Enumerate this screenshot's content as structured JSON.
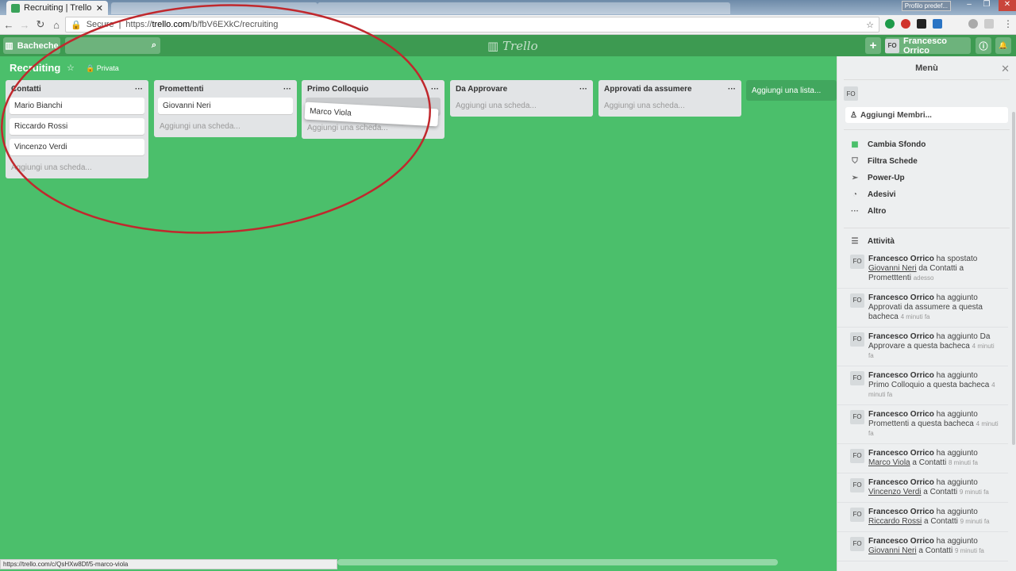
{
  "browser": {
    "tab_title": "Recruiting | Trello",
    "profile": "Profilo predef...",
    "url_secure": "Secure",
    "url_prefix": "https://",
    "url_domain": "trello.com",
    "url_path": "/b/fbV6EXkC/recruiting",
    "status_url": "https://trello.com/c/QsHXw8Df/5-marco-viola"
  },
  "header": {
    "boards": "Bacheche",
    "logo": "Trello",
    "add": "+",
    "user_initials": "FO",
    "user_name": "Francesco Orrico",
    "info": "ⓘ",
    "bell": "🔔"
  },
  "board": {
    "name": "Recruiting",
    "visibility": "Privata"
  },
  "lists": [
    {
      "title": "Contatti",
      "cards": [
        "Mario Bianchi",
        "Riccardo Rossi",
        "Vincenzo Verdi"
      ],
      "add": "Aggiungi una scheda..."
    },
    {
      "title": "Promettenti",
      "cards": [
        "Giovanni Neri"
      ],
      "add": "Aggiungi una scheda..."
    },
    {
      "title": "Primo Colloquio",
      "cards": [],
      "add": "Aggiungi una scheda..."
    },
    {
      "title": "Da Approvare",
      "cards": [],
      "add": "Aggiungi una scheda..."
    },
    {
      "title": "Approvati da assumere",
      "cards": [],
      "add": "Aggiungi una scheda..."
    }
  ],
  "dragging_card": "Marco Viola",
  "add_list": "Aggiungi una lista...",
  "menu": {
    "title": "Menù",
    "member": "FO",
    "add_members": "Aggiungi Membri...",
    "items": [
      "Cambia Sfondo",
      "Filtra Schede",
      "Power-Up",
      "Adesivi",
      "Altro"
    ],
    "activity_title": "Attività",
    "activities": [
      {
        "actor": "Francesco Orrico",
        "pre": " ha spostato ",
        "link": "Giovanni Neri",
        "post": " da Contatti a Prometttenti",
        "time": "adesso"
      },
      {
        "actor": "Francesco Orrico",
        "pre": " ha aggiunto Approvati da assumere a questa bacheca",
        "link": "",
        "post": "",
        "time": "4 minuti fa"
      },
      {
        "actor": "Francesco Orrico",
        "pre": " ha aggiunto Da Approvare a questa bacheca",
        "link": "",
        "post": "",
        "time": "4 minuti fa"
      },
      {
        "actor": "Francesco Orrico",
        "pre": " ha aggiunto Primo Colloquio a questa bacheca",
        "link": "",
        "post": "",
        "time": "4 minuti fa"
      },
      {
        "actor": "Francesco Orrico",
        "pre": " ha aggiunto Promettenti a questa bacheca",
        "link": "",
        "post": "",
        "time": "4 minuti fa"
      },
      {
        "actor": "Francesco Orrico",
        "pre": " ha aggiunto ",
        "link": "Marco Viola",
        "post": " a Contatti",
        "time": "8 minuti fa"
      },
      {
        "actor": "Francesco Orrico",
        "pre": " ha aggiunto ",
        "link": "Vincenzo Verdi",
        "post": " a Contatti",
        "time": "9 minuti fa"
      },
      {
        "actor": "Francesco Orrico",
        "pre": " ha aggiunto ",
        "link": "Riccardo Rossi",
        "post": " a Contatti",
        "time": "9 minuti fa"
      },
      {
        "actor": "Francesco Orrico",
        "pre": " ha aggiunto ",
        "link": "Giovanni Neri",
        "post": " a Contatti",
        "time": "9 minuti fa"
      }
    ]
  },
  "colors": {
    "board": "#4bbf6b",
    "header": "#3d9a51",
    "annotation": "#c0282d"
  }
}
